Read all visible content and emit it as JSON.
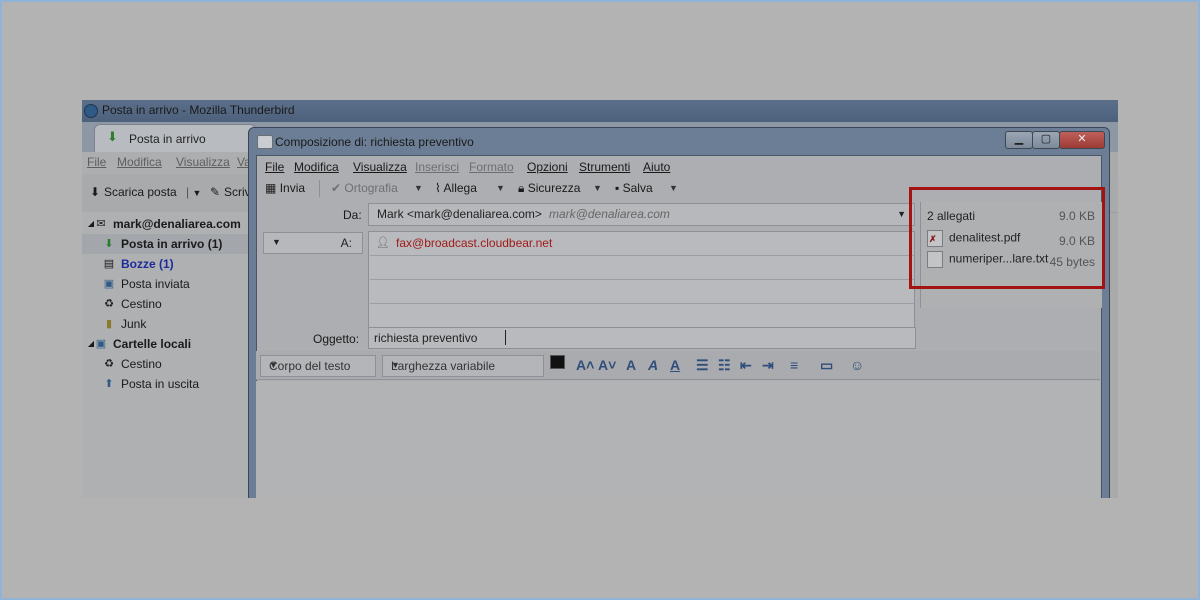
{
  "main_window": {
    "title": "Posta in arrivo - Mozilla Thunderbird",
    "tab": "Posta in arrivo",
    "menu": [
      "File",
      "Modifica",
      "Visualizza",
      "Va"
    ],
    "toolbar": {
      "get_mail": "Scarica posta",
      "write": "Scriv"
    },
    "folders": {
      "account": "mark@denaliarea.com",
      "inbox": "Posta in arrivo (1)",
      "drafts": "Bozze (1)",
      "sent": "Posta inviata",
      "trash": "Cestino",
      "junk": "Junk",
      "local": "Cartelle locali",
      "local_trash": "Cestino",
      "outbox": "Posta in uscita"
    }
  },
  "compose": {
    "title": "Composizione di: richiesta preventivo",
    "menu": {
      "file": "File",
      "modifica": "Modifica",
      "visualizza": "Visualizza",
      "inserisci": "Inserisci",
      "formato": "Formato",
      "opzioni": "Opzioni",
      "strumenti": "Strumenti",
      "aiuto": "Aiuto"
    },
    "toolbar": {
      "send": "Invia",
      "spell": "Ortografia",
      "attach": "Allega",
      "security": "Sicurezza",
      "save": "Salva"
    },
    "from_label": "Da:",
    "from_value": "Mark <mark@denaliarea.com>",
    "from_identity": "mark@denaliarea.com",
    "to_label": "A:",
    "to_value": "fax@broadcast.cloudbear.net",
    "subject_label": "Oggetto:",
    "subject_value": "richiesta preventivo",
    "attachments": {
      "header": "2 allegati",
      "total_size": "9.0 KB",
      "items": [
        {
          "name": "denalitest.pdf",
          "size": "9.0 KB"
        },
        {
          "name": "numeriper...lare.txt",
          "size": "45 bytes"
        }
      ]
    },
    "format": {
      "paragraph": "Corpo del testo",
      "font": "Larghezza variabile"
    },
    "highlight_color": "#a51212"
  }
}
